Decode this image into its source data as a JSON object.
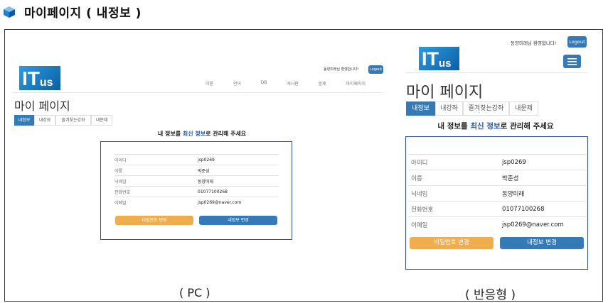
{
  "header": {
    "title": "마이페이지 ( 내정보 )"
  },
  "welcome": {
    "user": "동양미래",
    "suffix": "님 환영합니다!",
    "logout": "Logout"
  },
  "logo": {
    "big": "IT",
    "small": "us"
  },
  "nav": [
    "이론",
    "언어",
    "DB",
    "게시판",
    "문제",
    "마이페이지"
  ],
  "page_title": "마이 페이지",
  "tabs": [
    "내정보",
    "내강좌",
    "즐겨찾는강좌",
    "내문제"
  ],
  "notice": {
    "pre": "내 정보를 ",
    "highlight": "최신 정보",
    "post": "로 관리해 주세요"
  },
  "fields": [
    {
      "label": "아이디",
      "value": "jsp0269"
    },
    {
      "label": "이름",
      "value": "박준성"
    },
    {
      "label": "닉네임",
      "value": "동양미래"
    },
    {
      "label": "전화번호",
      "value": "01077100268"
    },
    {
      "label": "이메일",
      "value": "jsp0269@naver.com"
    }
  ],
  "buttons": {
    "password": "비밀번호 변경",
    "edit": "내정보 변경"
  },
  "captions": {
    "pc": "( PC )",
    "responsive": "( 반응형 )"
  }
}
